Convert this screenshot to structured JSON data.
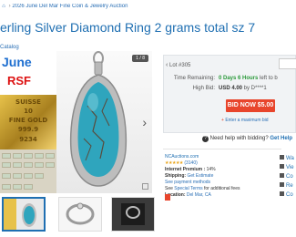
{
  "breadcrumb": {
    "home_icon": "home-icon",
    "sep": " › ",
    "auction": "2026 June Del Mar Fine Coin & Jewelry Auction"
  },
  "title": "erling Silver Diamond Ring 2 grams total sz 7",
  "catalog_label": "Catalog",
  "gallery": {
    "collage_text": {
      "june": "June",
      "rsf": "RSF"
    },
    "gold_bar_lines": [
      "SUISSE",
      "10",
      "FINE GOLD",
      "999.9",
      "9234"
    ],
    "counter": "1 / 8",
    "next_icon": "chevron-right-icon",
    "expand_icon": "expand-icon"
  },
  "lot": {
    "label": "Lot #305",
    "arrow": "‹"
  },
  "bidding": {
    "time_remaining_label": "Time Remaining:",
    "time_remaining_value": "0 Days 6 Hours",
    "time_remaining_extra": " left to b",
    "high_bid_label": "High Bid:",
    "high_bid_value": "USD 4.00",
    "high_bid_by": " by D****1",
    "bid_button": "BID NOW $5.00",
    "max_bid_icon": "+",
    "max_bid_link": "Enter a maximum bid"
  },
  "help": {
    "icon": "?",
    "text": "Need help with bidding? ",
    "link": "Get Help"
  },
  "seller": {
    "site": "NCAuctions.com",
    "stars": "★★★★★",
    "rating_count": "(3140)",
    "premium_label": "Internet Premium : ",
    "premium_value": "14%",
    "shipping_label": "Shipping: ",
    "shipping_value": "Get Estimate",
    "payment_value": "See payment methods",
    "special_prefix": "See ",
    "special_link": "Special Terms",
    "special_suffix": " for additional fees",
    "location_label": "Location: ",
    "location_value": "Del Mar, CA"
  },
  "side_links": [
    "Wa",
    "Vie",
    "Co",
    "Re",
    "Co"
  ],
  "colors": {
    "link": "#1f6fb2",
    "bid": "#e8452c",
    "time": "#2b9a3a"
  }
}
